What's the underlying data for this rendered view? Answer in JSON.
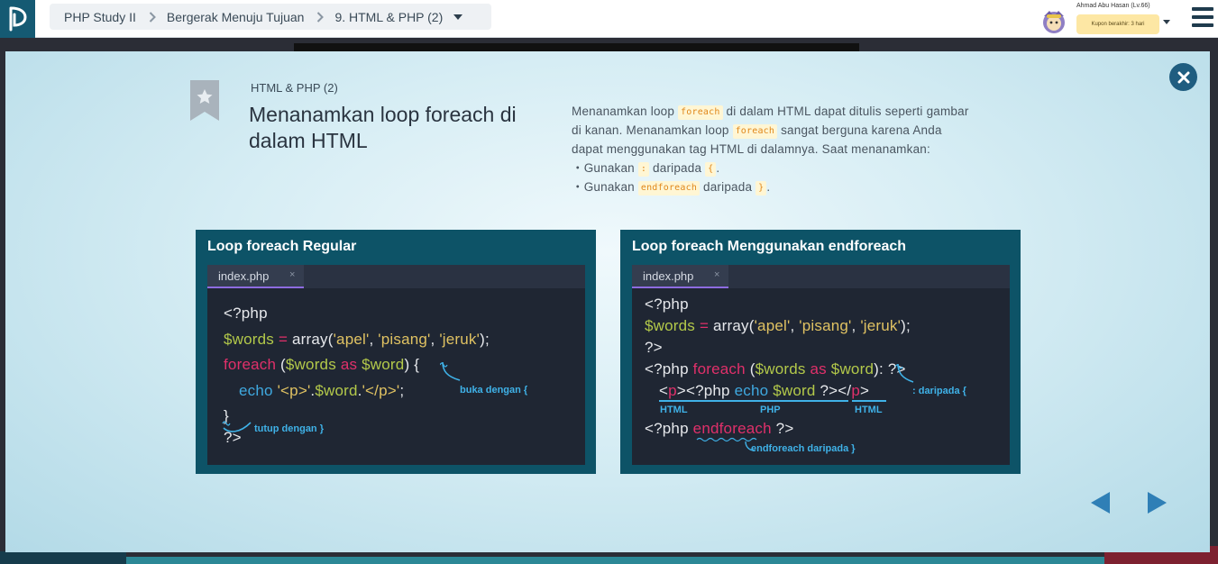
{
  "header": {
    "breadcrumb": {
      "course": "PHP Study II",
      "chapter": "Bergerak Menuju Tujuan",
      "lesson": "9. HTML & PHP (2)"
    },
    "user": {
      "name": "Ahmad Abu Hasan (Lv.66)",
      "coupon": "Kupon berakhir: 3 hari"
    }
  },
  "slide": {
    "label": "HTML & PHP (2)",
    "title_line1": "Menanamkan loop foreach di",
    "title_line2": "dalam HTML",
    "description": {
      "l1_a": "Menanamkan loop ",
      "l1_code": "foreach",
      "l1_b": " di dalam HTML dapat ditulis seperti gambar",
      "l2_a": "di kanan. Menanamkan loop ",
      "l2_code": "foreach",
      "l2_b": " sangat berguna karena Anda",
      "l3": "dapat menggunakan tag HTML di dalamnya. Saat menanamkan:",
      "b1_a": "・Gunakan ",
      "b1_code1": ":",
      "b1_b": " daripada ",
      "b1_code2": "{",
      "b1_c": ".",
      "b2_a": "・Gunakan ",
      "b2_code1": "endforeach",
      "b2_b": " daripada ",
      "b2_code2": "}",
      "b2_c": "."
    }
  },
  "panel_left": {
    "title": "Loop foreach Regular",
    "tab": "index.php",
    "tab_close": "×",
    "code": {
      "l1": "<?php",
      "l2_var": "$words",
      "l2_op": " = ",
      "l2_fn": "array(",
      "l2_s1": "'apel'",
      "l2_c1": ", ",
      "l2_s2": "'pisang'",
      "l2_c2": ", ",
      "l2_s3": "'jeruk'",
      "l2_end": ");",
      "l3_kw": "foreach",
      "l3_p1": " (",
      "l3_var1": "$words",
      "l3_as": " as ",
      "l3_var2": "$word",
      "l3_end": ") {",
      "l4_fn": "echo",
      "l4_s1": " '<p>'",
      "l4_dot1": ".",
      "l4_var": "$word",
      "l4_dot2": ".",
      "l4_s2": "'</p>'",
      "l4_end": ";",
      "l5": "}",
      "l6": "?>"
    },
    "ann_open": "buka dengan {",
    "ann_close": "tutup dengan }"
  },
  "panel_right": {
    "title": "Loop foreach Menggunakan endforeach",
    "tab": "index.php",
    "tab_close": "×",
    "code": {
      "l1": "<?php",
      "l2_var": "$words",
      "l2_op": " = ",
      "l2_fn": "array(",
      "l2_s1": "'apel'",
      "l2_c1": ", ",
      "l2_s2": "'pisang'",
      "l2_c2": ", ",
      "l2_s3": "'jeruk'",
      "l2_end": ");",
      "l3": "?>",
      "l4_open": "<?php ",
      "l4_kw": "foreach",
      "l4_p1": " (",
      "l4_var1": "$words",
      "l4_as": " as ",
      "l4_var2": "$word",
      "l4_end": "): ?>",
      "l5_t1a": "<",
      "l5_t1b": "p",
      "l5_t1c": ">",
      "l5_open": "<?php ",
      "l5_fn": "echo",
      "l5_sp": " ",
      "l5_var": "$word",
      "l5_close": " ?>",
      "l5_t2a": "</",
      "l5_t2b": "p",
      "l5_t2c": ">",
      "l6_open": "<?php ",
      "l6_kw": "endforeach",
      "l6_close": " ?>"
    },
    "label_html1": "HTML",
    "label_php": "PHP",
    "label_html2": "HTML",
    "ann_colon": ": daripada {",
    "ann_end": "endforeach daripada }"
  }
}
